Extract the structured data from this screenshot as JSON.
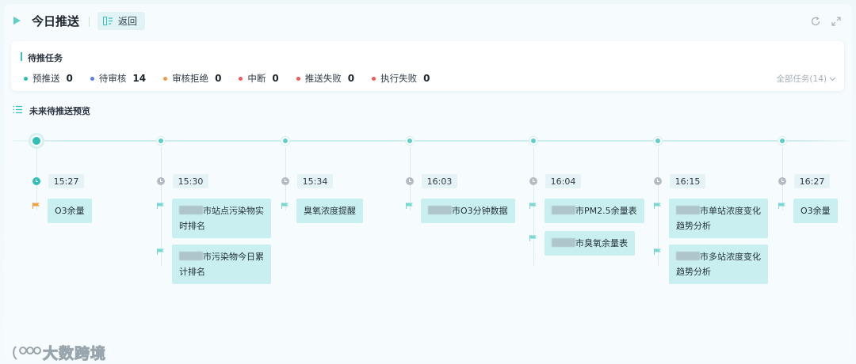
{
  "header": {
    "title": "今日推送",
    "back_label": "返回",
    "refresh_icon": "refresh-icon",
    "expand_icon": "expand-icon"
  },
  "pending": {
    "title": "待推任务",
    "stats": [
      {
        "label": "预推送",
        "value": "0",
        "color": "#2bbfb4"
      },
      {
        "label": "待审核",
        "value": "14",
        "color": "#5b7fe8"
      },
      {
        "label": "审核拒绝",
        "value": "0",
        "color": "#f09a4a"
      },
      {
        "label": "中断",
        "value": "0",
        "color": "#f05a5a"
      },
      {
        "label": "推送失败",
        "value": "0",
        "color": "#f05a5a"
      },
      {
        "label": "执行失败",
        "value": "0",
        "color": "#f05a5a"
      }
    ],
    "all_tasks_label": "全部任务(14)"
  },
  "preview": {
    "title": "未来待推送预览",
    "columns": [
      {
        "time": "15:27",
        "clock_color": "#2fbfb8",
        "flag_color": "#f2a13c",
        "tasks": [
          {
            "prefix": "",
            "text": "O3余量",
            "blur": false
          }
        ]
      },
      {
        "time": "15:30",
        "clock_color": "#b4bcc3",
        "flag_color": "#7ad7d1",
        "tasks": [
          {
            "prefix": "",
            "text": "市站点污染物实",
            "text2": "时排名",
            "blur": true
          },
          {
            "prefix": "",
            "text": "市污染物今日累",
            "text2": "计排名",
            "blur": true
          }
        ]
      },
      {
        "time": "15:34",
        "clock_color": "#b4bcc3",
        "flag_color": "#7ad7d1",
        "tasks": [
          {
            "prefix": "",
            "text": "臭氧浓度提醒",
            "blur": false
          }
        ]
      },
      {
        "time": "16:03",
        "clock_color": "#b4bcc3",
        "flag_color": "#7ad7d1",
        "tasks": [
          {
            "prefix": "",
            "text": "市O3分钟数据",
            "blur": true
          }
        ]
      },
      {
        "time": "16:04",
        "clock_color": "#b4bcc3",
        "flag_color": "#7ad7d1",
        "tasks": [
          {
            "prefix": "",
            "text": "市PM2.5余量表",
            "blur": true
          },
          {
            "prefix": "",
            "text": "市臭氧余量表",
            "blur": true
          }
        ]
      },
      {
        "time": "16:15",
        "clock_color": "#b4bcc3",
        "flag_color": "#7ad7d1",
        "tasks": [
          {
            "prefix": "",
            "text": "市单站浓度变化",
            "text2": "趋势分析",
            "blur": true
          },
          {
            "prefix": "",
            "text": "市多站浓度变化",
            "text2": "趋势分析",
            "blur": true
          }
        ]
      },
      {
        "time": "16:27",
        "clock_color": "#b4bcc3",
        "flag_color": "#7ad7d1",
        "tasks": [
          {
            "prefix": "",
            "text": "O3余量",
            "blur": false
          }
        ]
      }
    ]
  },
  "watermark": {
    "text": "大数跨境"
  }
}
